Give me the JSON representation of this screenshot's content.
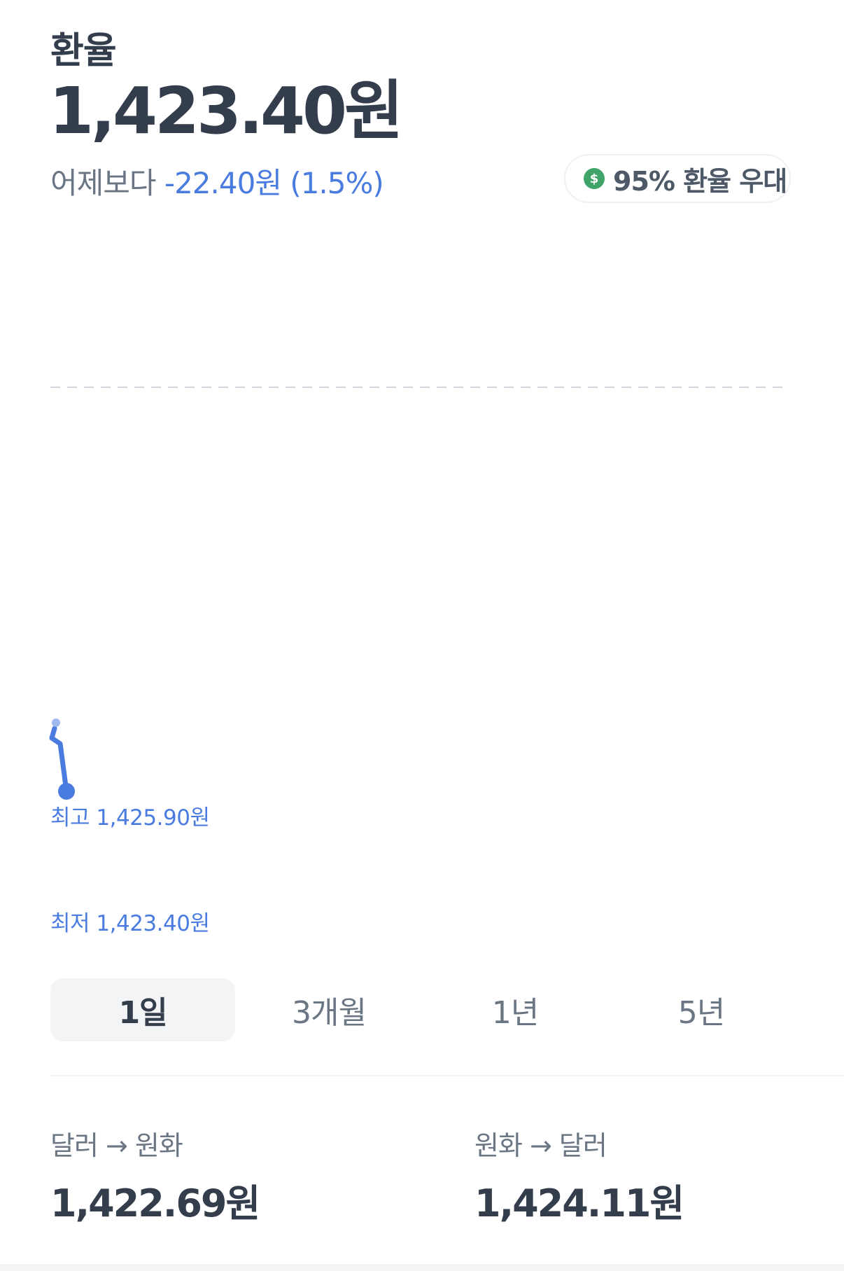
{
  "header": {
    "title": "환율",
    "rate": "1,423.40원",
    "change_prefix": "어제보다",
    "change_value": "-22.40원 (1.5%)"
  },
  "preference_chip": {
    "icon": "dollar-icon",
    "icon_glyph": "$",
    "label": "95% 환율 우대",
    "icon_color": "#3fa36a"
  },
  "chart_data": {
    "type": "line",
    "high_label": "최고 1,425.90원",
    "low_label": "최저 1,423.40원",
    "series": [
      {
        "x": [
          0,
          1,
          2
        ],
        "values": [
          1425.9,
          1425.6,
          1423.4
        ]
      }
    ],
    "ylim": [
      1423.4,
      1425.9
    ],
    "color": "#4a7ce0"
  },
  "tabs": [
    {
      "label": "1일",
      "active": true
    },
    {
      "label": "3개월",
      "active": false
    },
    {
      "label": "1년",
      "active": false
    },
    {
      "label": "5년",
      "active": false
    }
  ],
  "conversion": {
    "usd_to_krw": {
      "label": "달러 → 원화",
      "value": "1,422.69원"
    },
    "krw_to_usd": {
      "label": "원화 → 달러",
      "value": "1,424.11원"
    }
  }
}
